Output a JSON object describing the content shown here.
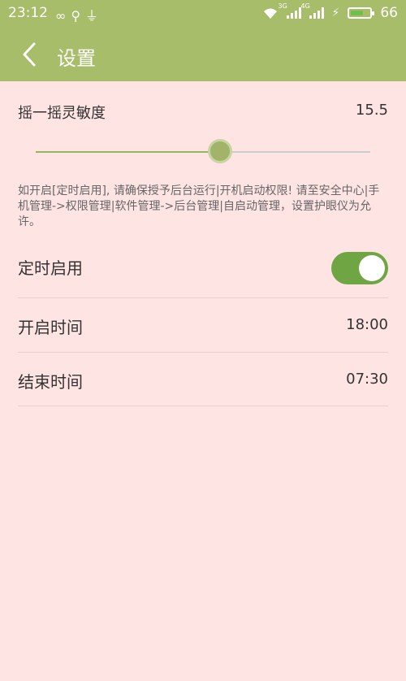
{
  "status_bar": {
    "time": "23:12",
    "left_icons": [
      "infinity-icon",
      "usb-share-icon",
      "usb-icon"
    ],
    "signal1_tag": "3G",
    "signal2_tag": "4G",
    "battery_level": "66",
    "battery_fraction": 0.66
  },
  "header": {
    "title": "设置",
    "back_icon": "chevron-left-icon"
  },
  "sensitivity": {
    "label": "摇一摇灵敏度",
    "value": "15.5",
    "slider_fraction": 0.55
  },
  "notice": "如开启[定时启用], 请确保授予后台运行|开机启动权限! 请至安全中心|手机管理->权限管理|软件管理->后台管理|自启动管理，设置护眼仪为允许。",
  "settings": {
    "timer_enable": {
      "label": "定时启用",
      "on": true
    },
    "start_time": {
      "label": "开启时间",
      "value": "18:00"
    },
    "end_time": {
      "label": "结束时间",
      "value": "07:30"
    }
  },
  "colors": {
    "header_bg": "#a8bd6a",
    "page_bg": "#ffe4e4",
    "toggle_on": "#6fa542"
  }
}
